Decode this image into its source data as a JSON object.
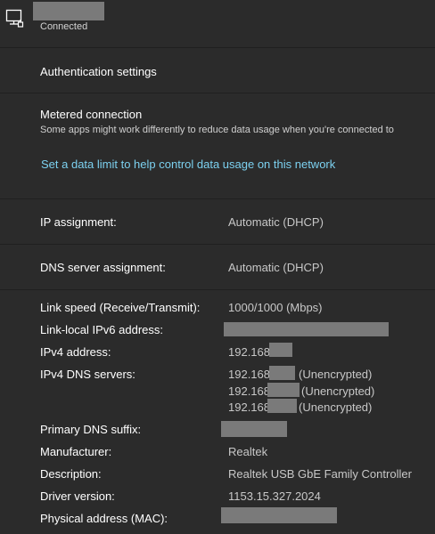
{
  "header": {
    "status": "Connected",
    "icon": "ethernet-network-icon"
  },
  "auth": {
    "label": "Authentication settings"
  },
  "metered": {
    "title": "Metered connection",
    "description": "Some apps might work differently to reduce data usage when you're connected to",
    "data_limit_link": "Set a data limit to help control data usage on this network"
  },
  "ip_assignment": {
    "label": "IP assignment:",
    "value": "Automatic (DHCP)"
  },
  "dns_assignment": {
    "label": "DNS server assignment:",
    "value": "Automatic (DHCP)"
  },
  "details": {
    "link_speed": {
      "label": "Link speed (Receive/Transmit):",
      "value": "1000/1000 (Mbps)"
    },
    "ipv6": {
      "label": "Link-local IPv6 address:"
    },
    "ipv4": {
      "label": "IPv4 address:",
      "value_prefix": "192.168."
    },
    "dns_servers": {
      "label": "IPv4 DNS servers:",
      "entries": [
        {
          "prefix": "192.168.",
          "suffix": "(Unencrypted)"
        },
        {
          "prefix": "192.168",
          "suffix": "(Unencrypted)"
        },
        {
          "prefix": "192.168",
          "suffix": "(Unencrypted)"
        }
      ]
    },
    "dns_suffix": {
      "label": "Primary DNS suffix:"
    },
    "manufacturer": {
      "label": "Manufacturer:",
      "value": "Realtek"
    },
    "description": {
      "label": "Description:",
      "value": "Realtek USB GbE Family Controller"
    },
    "driver": {
      "label": "Driver version:",
      "value": "1153.15.327.2024"
    },
    "mac": {
      "label": "Physical address (MAC):"
    }
  }
}
